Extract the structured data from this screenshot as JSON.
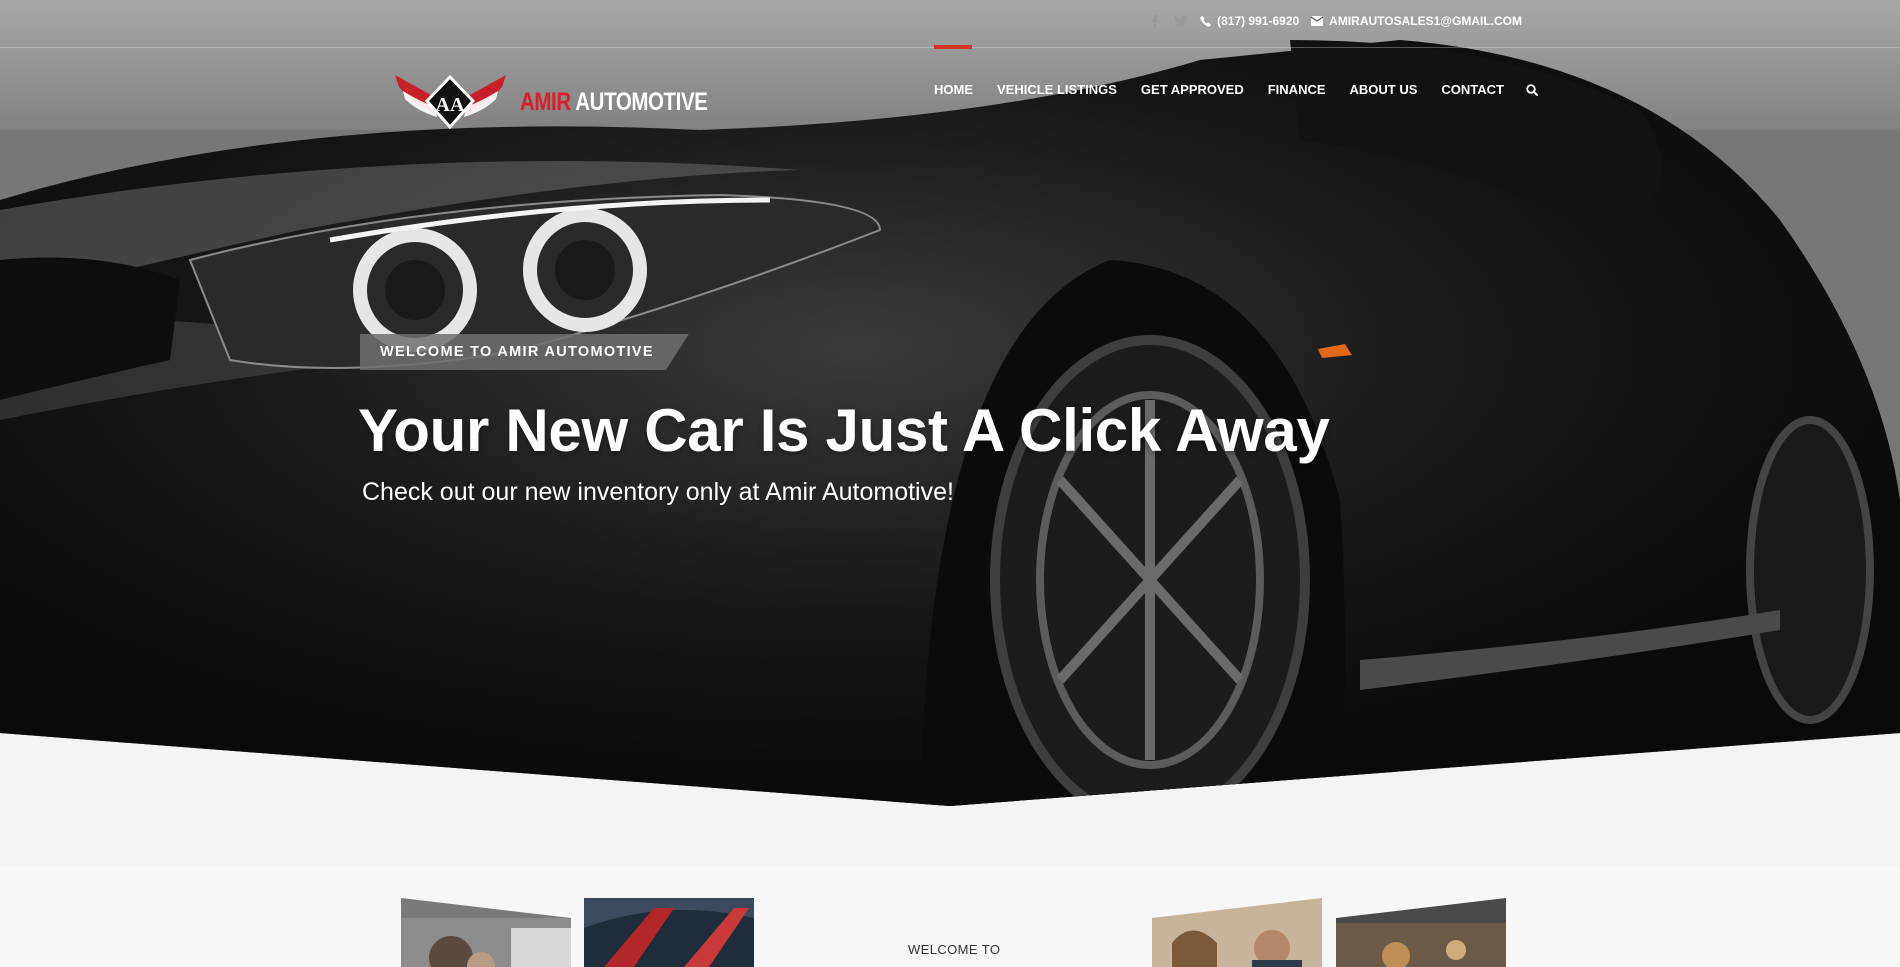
{
  "topbar": {
    "social": [
      "facebook-icon",
      "twitter-icon"
    ],
    "phone": "(817) 991-6920",
    "email": "AMIRAUTOSALES1@GMAIL.COM"
  },
  "logo": {
    "mark": "AA",
    "name_red": "AMIR",
    "name_white": "AUTOMOTIVE"
  },
  "nav": {
    "items": [
      {
        "label": "HOME",
        "active": true
      },
      {
        "label": "VEHICLE LISTINGS"
      },
      {
        "label": "GET APPROVED"
      },
      {
        "label": "FINANCE"
      },
      {
        "label": "ABOUT US"
      },
      {
        "label": "CONTACT"
      }
    ],
    "search_icon": "search-icon"
  },
  "hero": {
    "eyebrow": "WELCOME TO AMIR AUTOMOTIVE",
    "title": "Your New Car Is Just A Click Away",
    "subtitle": "Check out our new inventory only at Amir Automotive!"
  },
  "welcome": {
    "label": "WELCOME TO"
  },
  "colors": {
    "accent": "#d0362a",
    "brand_red": "#d8202c",
    "band_bg": "#f7f7f7"
  }
}
